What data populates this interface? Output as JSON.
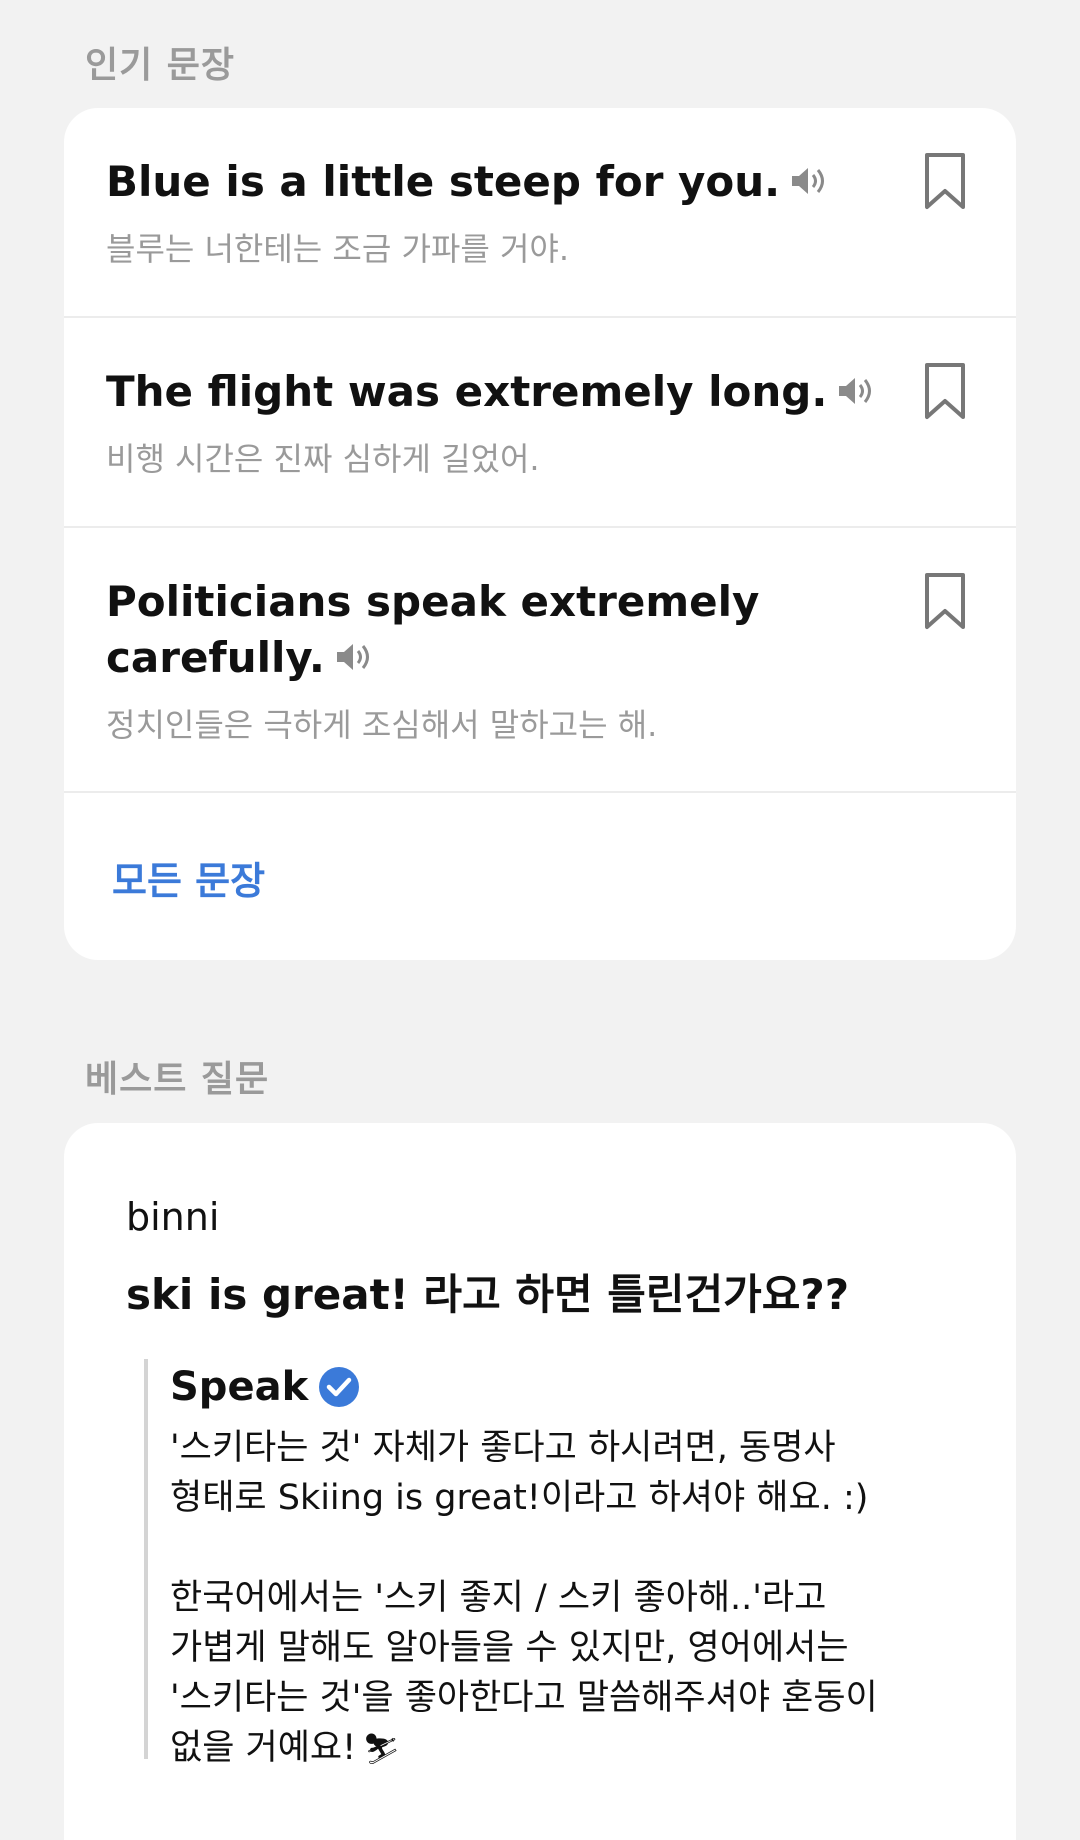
{
  "popular": {
    "title": "인기 문장",
    "sentences": [
      {
        "en": "Blue is a little steep for you.",
        "ko": "블루는 너한테는 조금 가파를 거야."
      },
      {
        "en": "The flight was extremely long.",
        "ko": "비행 시간은 진짜 심하게 길었어."
      },
      {
        "en": "Politicians speak extremely carefully.",
        "ko": "정치인들은 극하게 조심해서 말하고는 해."
      }
    ],
    "all_link": "모든 문장",
    "icons": {
      "speaker": "speaker-icon",
      "bookmark": "bookmark-icon"
    },
    "colors": {
      "link": "#3b7ad9",
      "secondary_text": "#9a9a9a"
    }
  },
  "best_questions": {
    "title": "베스트 질문",
    "question": {
      "user": "binni",
      "text": "ski is great! 라고 하면 틀린건가요??"
    },
    "answer": {
      "author": "Speak",
      "verified_icon": "verified-check-icon",
      "body": "'스키타는 것' 자체가 좋다고 하시려면, 동명사\n형태로 Skiing is great!이라고 하셔야 해요. :)\n\n한국어에서는 '스키 좋지 / 스키 좋아해..'라고\n가볍게 말해도 알아들을 수 있지만, 영어에서는\n'스키타는 것'을 좋아한다고 말씀해주셔야 혼동이\n없을 거예요!",
      "emoji": "⛷"
    }
  }
}
